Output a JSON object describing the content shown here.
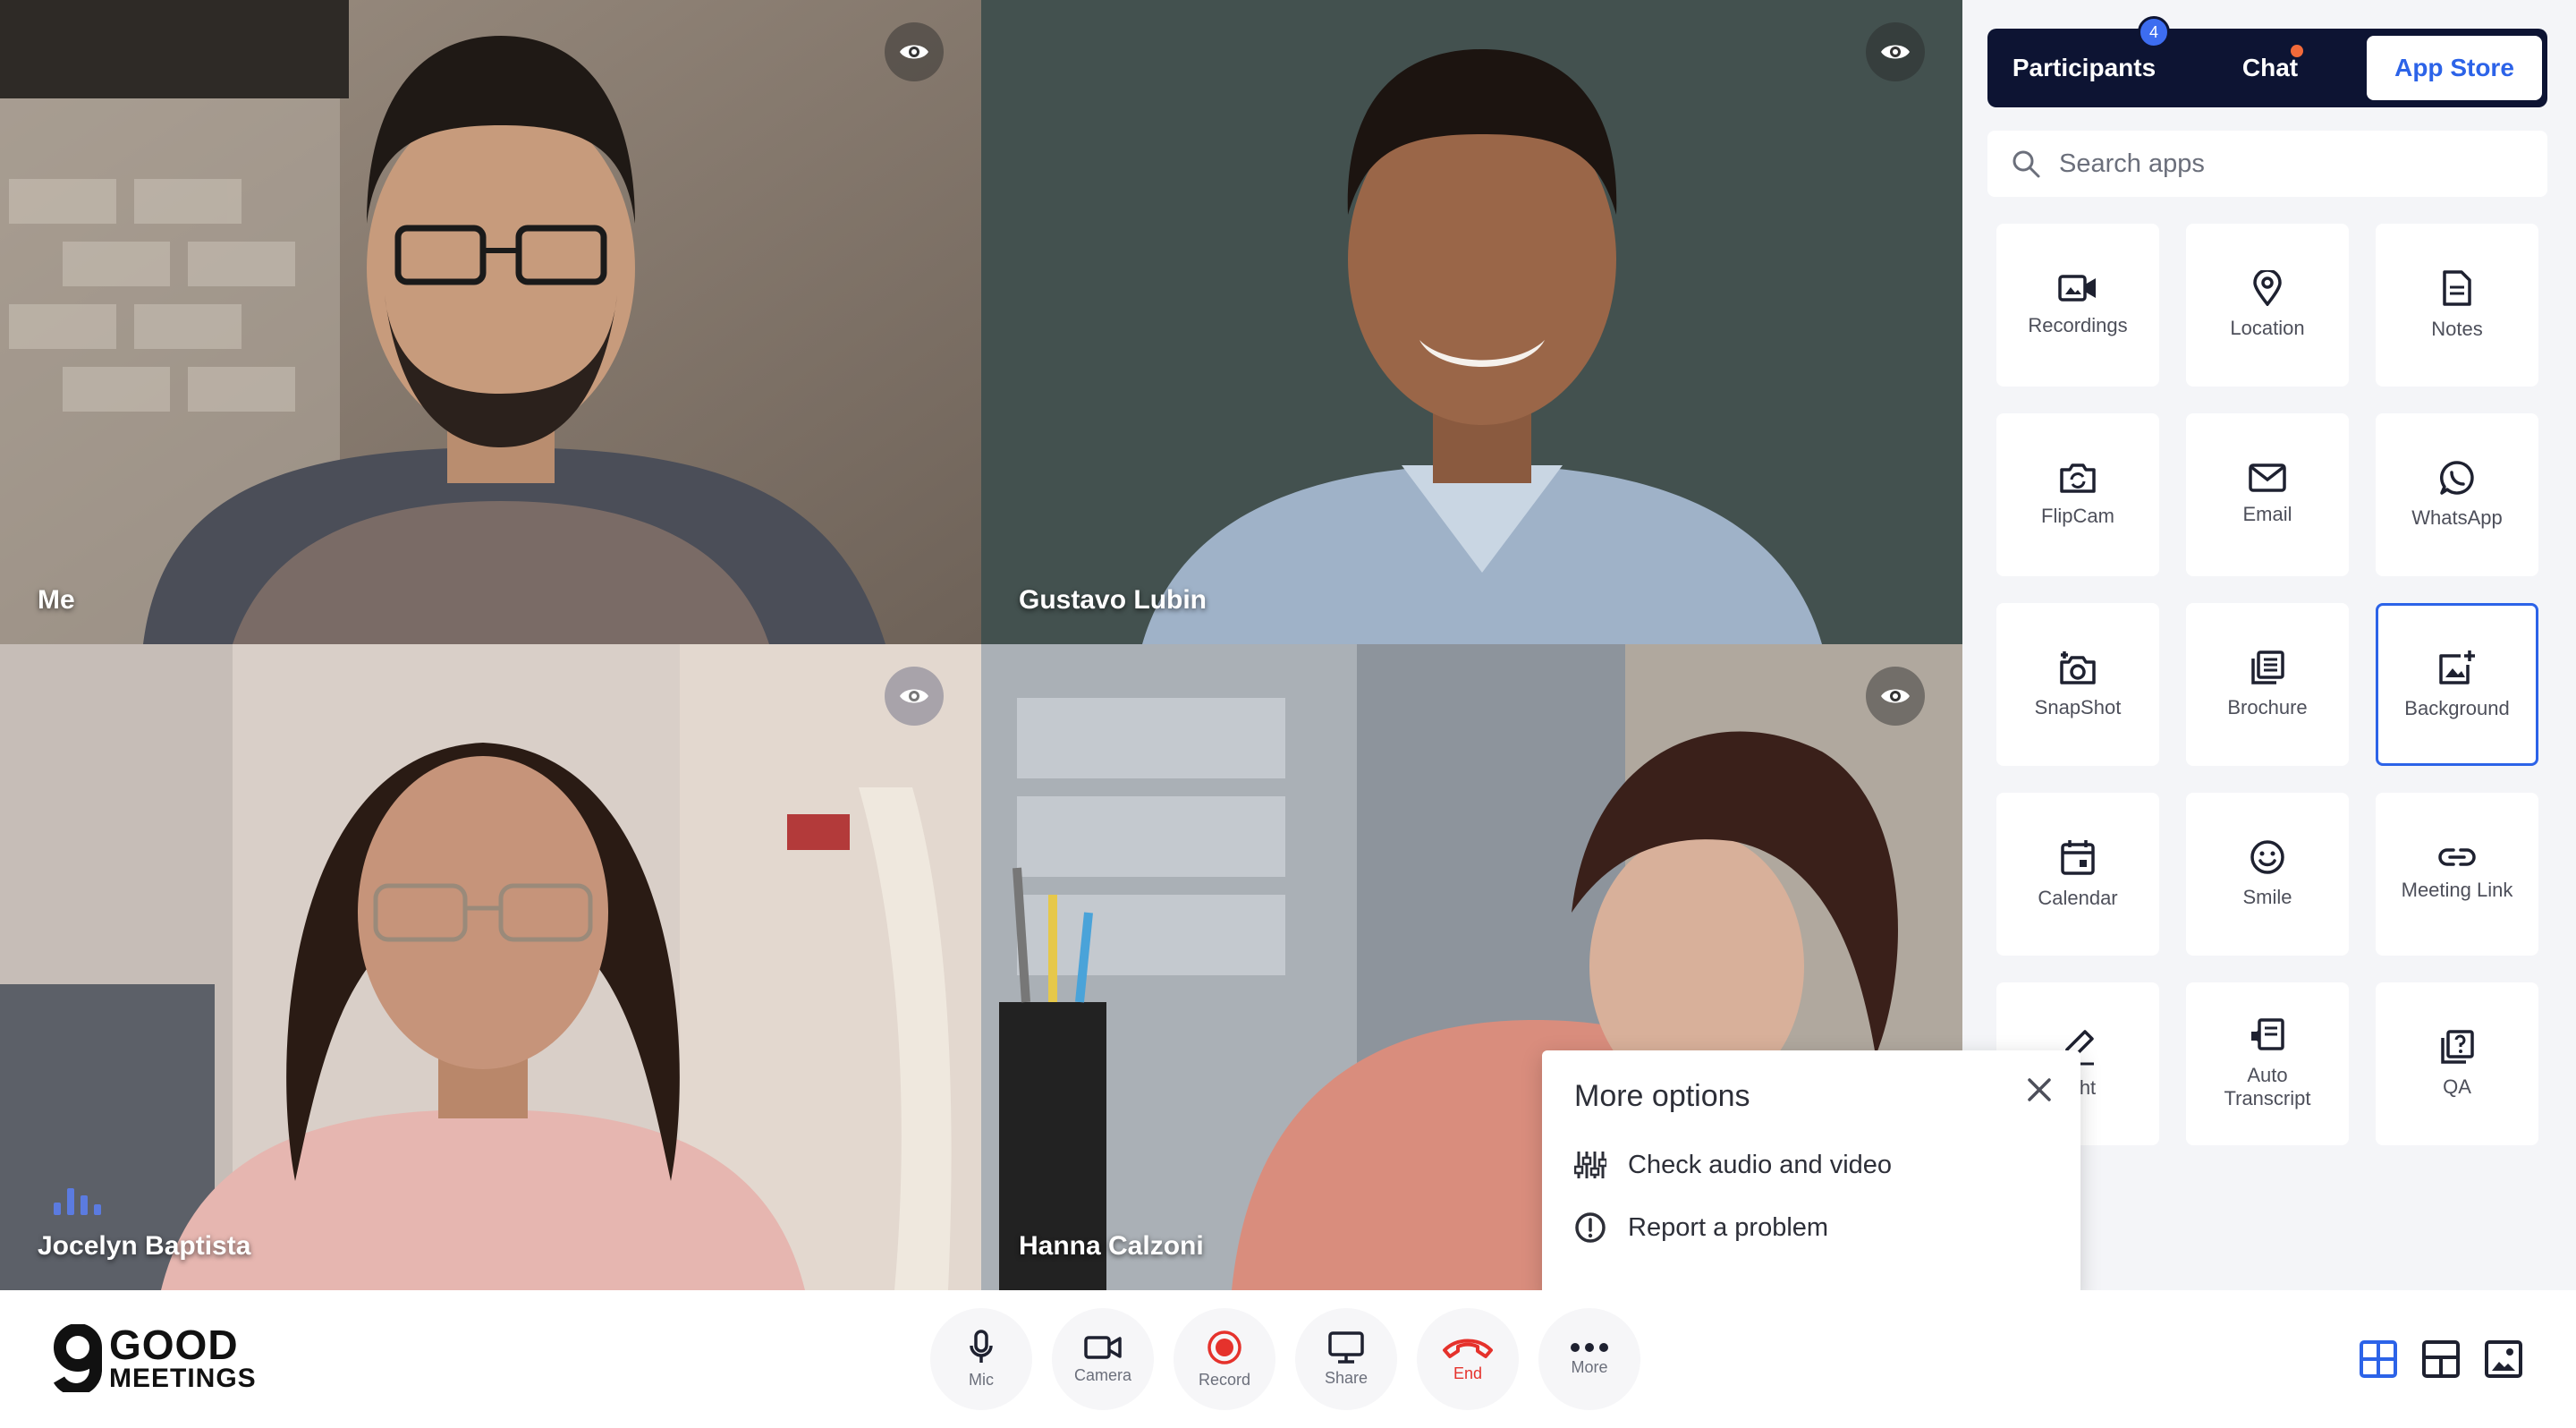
{
  "tiles": [
    {
      "name": "Me"
    },
    {
      "name": "Gustavo Lubin"
    },
    {
      "name": "Jocelyn Baptista"
    },
    {
      "name": "Hanna Calzoni"
    }
  ],
  "sidebar": {
    "tabs": [
      {
        "label": "Participants",
        "badge": "4"
      },
      {
        "label": "Chat"
      },
      {
        "label": "App Store"
      }
    ],
    "search_placeholder": "Search apps",
    "apps": [
      {
        "label": "Recordings",
        "icon": "video-camera-icon"
      },
      {
        "label": "Location",
        "icon": "location-pin-icon"
      },
      {
        "label": "Notes",
        "icon": "document-icon"
      },
      {
        "label": "FlipCam",
        "icon": "flip-camera-icon"
      },
      {
        "label": "Email",
        "icon": "envelope-icon"
      },
      {
        "label": "WhatsApp",
        "icon": "whatsapp-icon"
      },
      {
        "label": "SnapShot",
        "icon": "snapshot-camera-icon"
      },
      {
        "label": "Brochure",
        "icon": "brochure-icon"
      },
      {
        "label": "Background",
        "icon": "image-add-icon"
      },
      {
        "label": "Calendar",
        "icon": "calendar-icon"
      },
      {
        "label": "Smile",
        "icon": "smile-icon"
      },
      {
        "label": "Meeting Link",
        "icon": "link-icon"
      },
      {
        "label": "light",
        "icon": "pencil-icon"
      },
      {
        "label": "Auto\nTranscript",
        "icon": "transcript-icon"
      },
      {
        "label": "QA",
        "icon": "question-icon"
      }
    ]
  },
  "more_options": {
    "title": "More options",
    "items": [
      {
        "label": "Check audio and video",
        "icon": "equalizer-icon"
      },
      {
        "label": "Report a problem",
        "icon": "alert-icon"
      }
    ]
  },
  "logo": {
    "line1": "GOOD",
    "line2": "MEETINGS"
  },
  "toolbar": {
    "controls": [
      {
        "label": "Mic"
      },
      {
        "label": "Camera"
      },
      {
        "label": "Record"
      },
      {
        "label": "Share"
      },
      {
        "label": "End"
      },
      {
        "label": "More"
      }
    ]
  },
  "colors": {
    "accent": "#2c63e8",
    "navy": "#0d1433",
    "danger": "#e5322c",
    "sidebar_bg": "#f4f5f8"
  }
}
